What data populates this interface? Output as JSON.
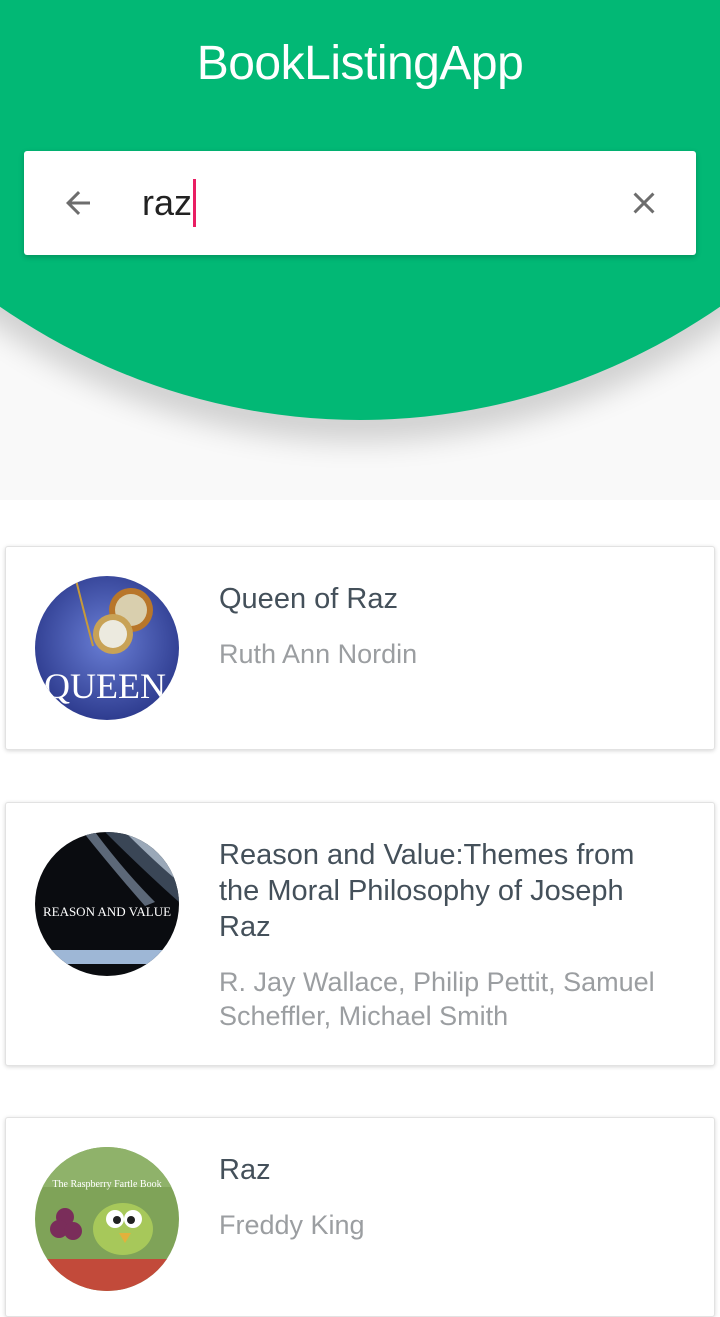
{
  "app": {
    "title": "BookListingApp",
    "accent_color": "#02b875",
    "cursor_color": "#e91e63"
  },
  "search": {
    "back_icon": "arrow-back-icon",
    "query": "raz",
    "clear_icon": "close-icon"
  },
  "books": [
    {
      "title": "Queen of Raz",
      "author": "Ruth Ann Nordin",
      "cover_text": "QUEEN"
    },
    {
      "title": "Reason and Value:Themes from the Moral Philosophy of Joseph Raz",
      "author": "R. Jay Wallace, Philip Pettit, Samuel Scheffler, Michael Smith",
      "cover_text": "REASON AND VALUE"
    },
    {
      "title": "Raz",
      "author": "Freddy King",
      "cover_text": "The Raspberry Fartle Book"
    }
  ]
}
